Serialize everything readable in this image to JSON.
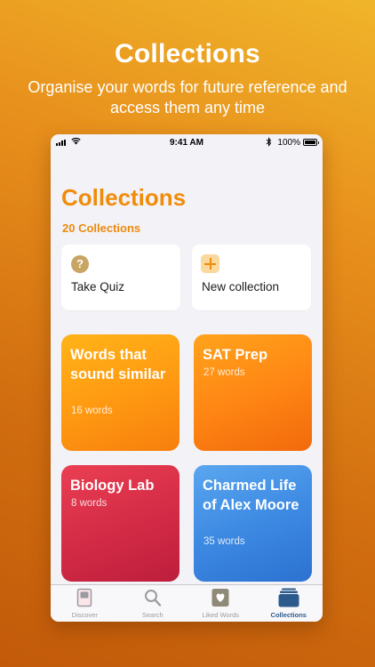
{
  "promo": {
    "title": "Collections",
    "subtitle": "Organise your words for future reference and access them any time"
  },
  "status_bar": {
    "time": "9:41 AM",
    "battery": "100%"
  },
  "page": {
    "title": "Collections",
    "count": "20 Collections"
  },
  "actions": [
    {
      "label": "Take Quiz",
      "icon": "question-mark-icon"
    },
    {
      "label": "New collection",
      "icon": "plus-icon"
    }
  ],
  "collections": [
    {
      "title": "Words that sound similar",
      "count": "16 words",
      "color": "#ff9b12"
    },
    {
      "title": "SAT Prep",
      "count": "27 words",
      "color": "#ff8714"
    },
    {
      "title": "Biology Lab",
      "count": "8 words",
      "color": "#d52c47"
    },
    {
      "title": "Charmed Life of Alex Moore",
      "count": "35 words",
      "color": "#3d8ae3"
    }
  ],
  "tabs": [
    {
      "label": "Discover",
      "icon": "book-icon",
      "active": false
    },
    {
      "label": "Search",
      "icon": "search-icon",
      "active": false
    },
    {
      "label": "Liked Words",
      "icon": "heart-card-icon",
      "active": false
    },
    {
      "label": "Collections",
      "icon": "collections-stack-icon",
      "active": true
    }
  ],
  "colors": {
    "accent": "#f08c0a",
    "active_tab": "#2c5a8c"
  }
}
